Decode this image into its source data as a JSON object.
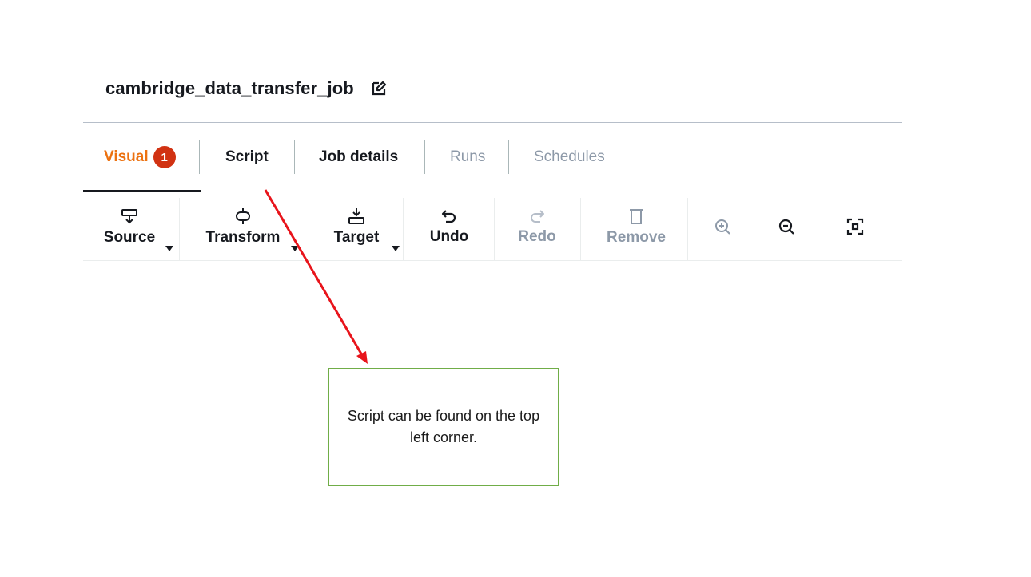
{
  "job": {
    "title": "cambridge_data_transfer_job",
    "edit_icon": "edit-icon"
  },
  "tabs": [
    {
      "label": "Visual",
      "badge": "1",
      "state": "active"
    },
    {
      "label": "Script",
      "state": "normal"
    },
    {
      "label": "Job details",
      "state": "normal"
    },
    {
      "label": "Runs",
      "state": "disabled"
    },
    {
      "label": "Schedules",
      "state": "disabled"
    }
  ],
  "toolbar": {
    "source": {
      "label": "Source",
      "icon": "source-node-icon",
      "has_dropdown": true
    },
    "transform": {
      "label": "Transform",
      "icon": "transform-node-icon",
      "has_dropdown": true
    },
    "target": {
      "label": "Target",
      "icon": "target-node-icon",
      "has_dropdown": true
    },
    "undo": {
      "label": "Undo",
      "icon": "undo-icon",
      "enabled": true
    },
    "redo": {
      "label": "Redo",
      "icon": "redo-icon",
      "enabled": false
    },
    "remove": {
      "label": "Remove",
      "icon": "trash-icon",
      "enabled": false
    },
    "zoom_in": {
      "icon": "zoom-in-icon",
      "enabled": false
    },
    "zoom_out": {
      "icon": "zoom-out-icon",
      "enabled": true
    },
    "fit": {
      "icon": "fit-to-screen-icon",
      "enabled": true
    }
  },
  "annotation": {
    "text": "Script can be found on the top left corner.",
    "arrow_color": "#e8141b",
    "border_color": "#70ad47"
  },
  "colors": {
    "accent": "#ec7211",
    "badge": "#d13212",
    "text": "#16191f",
    "disabled": "#8d99a8"
  }
}
